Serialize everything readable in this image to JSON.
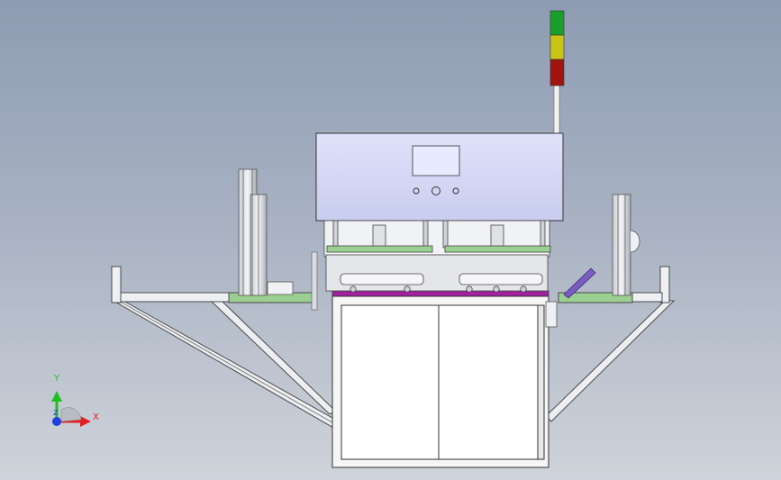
{
  "triad": {
    "y_label": "Y",
    "z_label": "Z",
    "x_label": "X",
    "colors": {
      "y": "#20c020",
      "x": "#e02020",
      "z": "#2040e0"
    }
  },
  "colors": {
    "background_top": "#8e9cb3",
    "background_bottom": "#cfd3da",
    "machine_head": "#d4d8f4",
    "green_rail": "#9bcf92",
    "magenta_rail": "#a020a0",
    "signal_green": "#1b9e2a",
    "signal_yellow": "#c9c415",
    "signal_red": "#a01510",
    "frame_stroke": "#4a4a4a"
  }
}
